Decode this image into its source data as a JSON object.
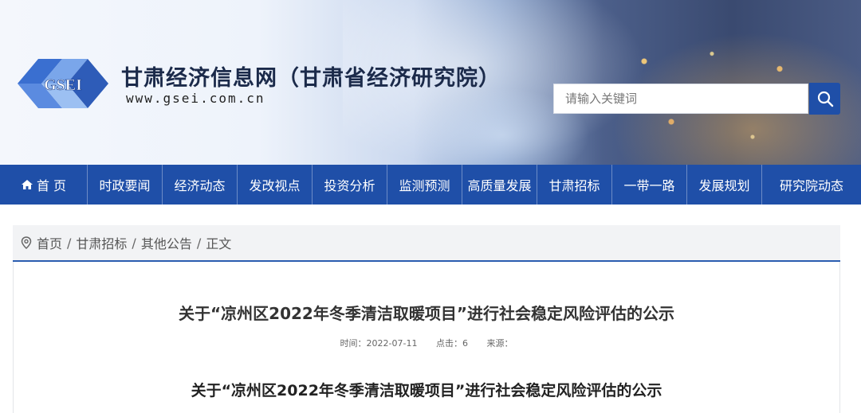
{
  "header": {
    "site_title": "甘肃经济信息网（甘肃省经济研究院）",
    "site_url": "www.gsei.com.cn",
    "logo_text": "GSEI",
    "search_placeholder": "请输入关键词"
  },
  "nav": {
    "items": [
      {
        "label": "首 页",
        "icon": "home-icon"
      },
      {
        "label": "时政要闻"
      },
      {
        "label": "经济动态"
      },
      {
        "label": "发改视点"
      },
      {
        "label": "投资分析"
      },
      {
        "label": "监测预测"
      },
      {
        "label": "高质量发展"
      },
      {
        "label": "甘肃招标"
      },
      {
        "label": "一带一路"
      },
      {
        "label": "发展规划"
      },
      {
        "label": "研究院动态"
      }
    ]
  },
  "breadcrumb": {
    "items": [
      "首页",
      "甘肃招标",
      "其他公告",
      "正文"
    ],
    "separator": "/"
  },
  "article": {
    "title": "关于“凉州区2022年冬季清洁取暖项目”进行社会稳定风险评估的公示",
    "meta_time": "时间：2022-07-11",
    "meta_clicks": "点击：6",
    "meta_source": "来源：",
    "body_title": "关于“凉州区2022年冬季清洁取暖项目”进行社会稳定风险评估的公示"
  },
  "colors": {
    "nav_bg": "#1f4fa8",
    "accent": "#2a5db0",
    "crumb_bg": "#f2f3f5"
  }
}
